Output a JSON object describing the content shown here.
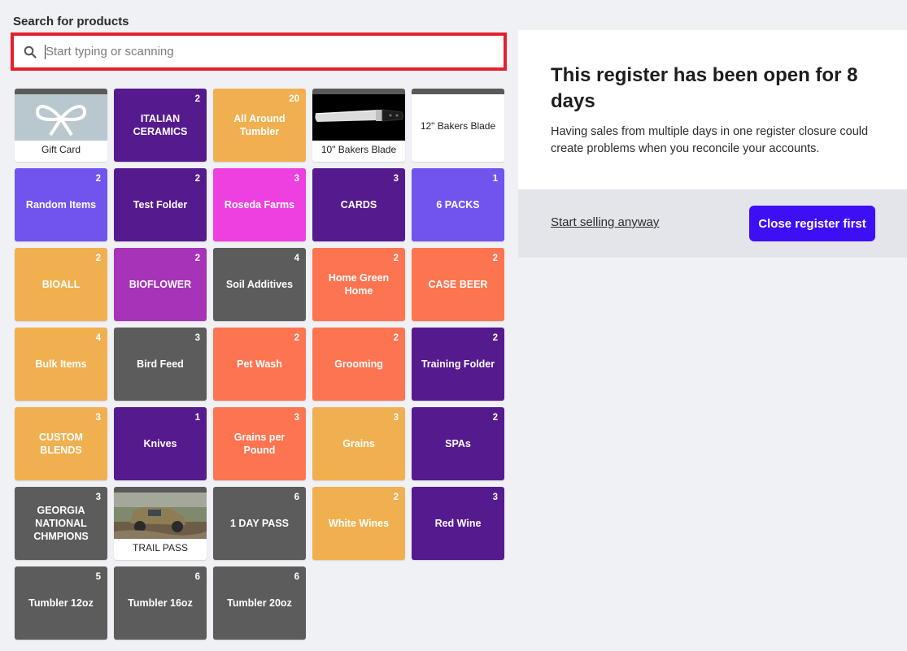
{
  "search": {
    "label": "Search for products",
    "placeholder": "Start typing or scanning",
    "icon": "search-icon"
  },
  "tiles": [
    {
      "type": "product",
      "label": "Gift Card",
      "image": "gift-card-bow",
      "color": "#b9c8cf"
    },
    {
      "type": "folder",
      "label": "ITALIAN CERAMICS",
      "count": "2",
      "color": "#561a8f"
    },
    {
      "type": "folder",
      "label": "All Around Tumbler",
      "count": "20",
      "color": "#f0b050"
    },
    {
      "type": "product",
      "label": "10\" Bakers Blade",
      "image": "bread-knife"
    },
    {
      "type": "product-noimg",
      "label": "12\" Bakers Blade"
    },
    {
      "type": "folder",
      "label": "Random Items",
      "count": "2",
      "color": "#7153ee"
    },
    {
      "type": "folder",
      "label": "Test Folder",
      "count": "2",
      "color": "#561a8f"
    },
    {
      "type": "folder",
      "label": "Roseda Farms",
      "count": "3",
      "color": "#ee3fe1"
    },
    {
      "type": "folder",
      "label": "CARDS",
      "count": "3",
      "color": "#561a8f"
    },
    {
      "type": "folder",
      "label": "6 PACKS",
      "count": "1",
      "color": "#7153ee"
    },
    {
      "type": "folder",
      "label": "BIOALL",
      "count": "2",
      "color": "#f0b050"
    },
    {
      "type": "folder",
      "label": "BIOFLOWER",
      "count": "2",
      "color": "#a633b8"
    },
    {
      "type": "folder",
      "label": "Soil Additives",
      "count": "4",
      "color": "#5c5c5c"
    },
    {
      "type": "folder",
      "label": "Home Green Home",
      "count": "2",
      "color": "#fd7450"
    },
    {
      "type": "folder",
      "label": "CASE BEER",
      "count": "2",
      "color": "#fd7450"
    },
    {
      "type": "folder",
      "label": "Bulk Items",
      "count": "4",
      "color": "#f0b050"
    },
    {
      "type": "folder",
      "label": "Bird Feed",
      "count": "3",
      "color": "#5c5c5c"
    },
    {
      "type": "folder",
      "label": "Pet Wash",
      "count": "2",
      "color": "#fd7450"
    },
    {
      "type": "folder",
      "label": "Grooming",
      "count": "2",
      "color": "#fd7450"
    },
    {
      "type": "folder",
      "label": "Training Folder",
      "count": "2",
      "color": "#561a8f"
    },
    {
      "type": "folder",
      "label": "CUSTOM BLENDS",
      "count": "3",
      "color": "#f0b050"
    },
    {
      "type": "folder",
      "label": "Knives",
      "count": "1",
      "color": "#561a8f"
    },
    {
      "type": "folder",
      "label": "Grains per Pound",
      "count": "3",
      "color": "#fd7450"
    },
    {
      "type": "folder",
      "label": "Grains",
      "count": "3",
      "color": "#f0b050"
    },
    {
      "type": "folder",
      "label": "SPAs",
      "count": "2",
      "color": "#561a8f"
    },
    {
      "type": "folder",
      "label": "GEORGIA NATIONAL CHMPIONS",
      "count": "3",
      "color": "#5c5c5c"
    },
    {
      "type": "product",
      "label": "TRAIL PASS",
      "image": "mud-truck"
    },
    {
      "type": "folder",
      "label": "1 DAY PASS",
      "count": "6",
      "color": "#5c5c5c"
    },
    {
      "type": "folder",
      "label": "White Wines",
      "count": "2",
      "color": "#f0b050"
    },
    {
      "type": "folder",
      "label": "Red Wine",
      "count": "3",
      "color": "#561a8f"
    },
    {
      "type": "folder",
      "label": "Tumbler 12oz",
      "count": "5",
      "color": "#5c5c5c"
    },
    {
      "type": "folder",
      "label": "Tumbler 16oz",
      "count": "6",
      "color": "#5c5c5c"
    },
    {
      "type": "folder",
      "label": "Tumbler 20oz",
      "count": "6",
      "color": "#5c5c5c"
    }
  ],
  "notice": {
    "title": "This register has been open for 8 days",
    "body": "Having sales from multiple days in one register closure could create problems when you reconcile your accounts.",
    "secondary_label": "Start selling anyway",
    "primary_label": "Close register first",
    "primary_color": "#3d0ff5"
  }
}
